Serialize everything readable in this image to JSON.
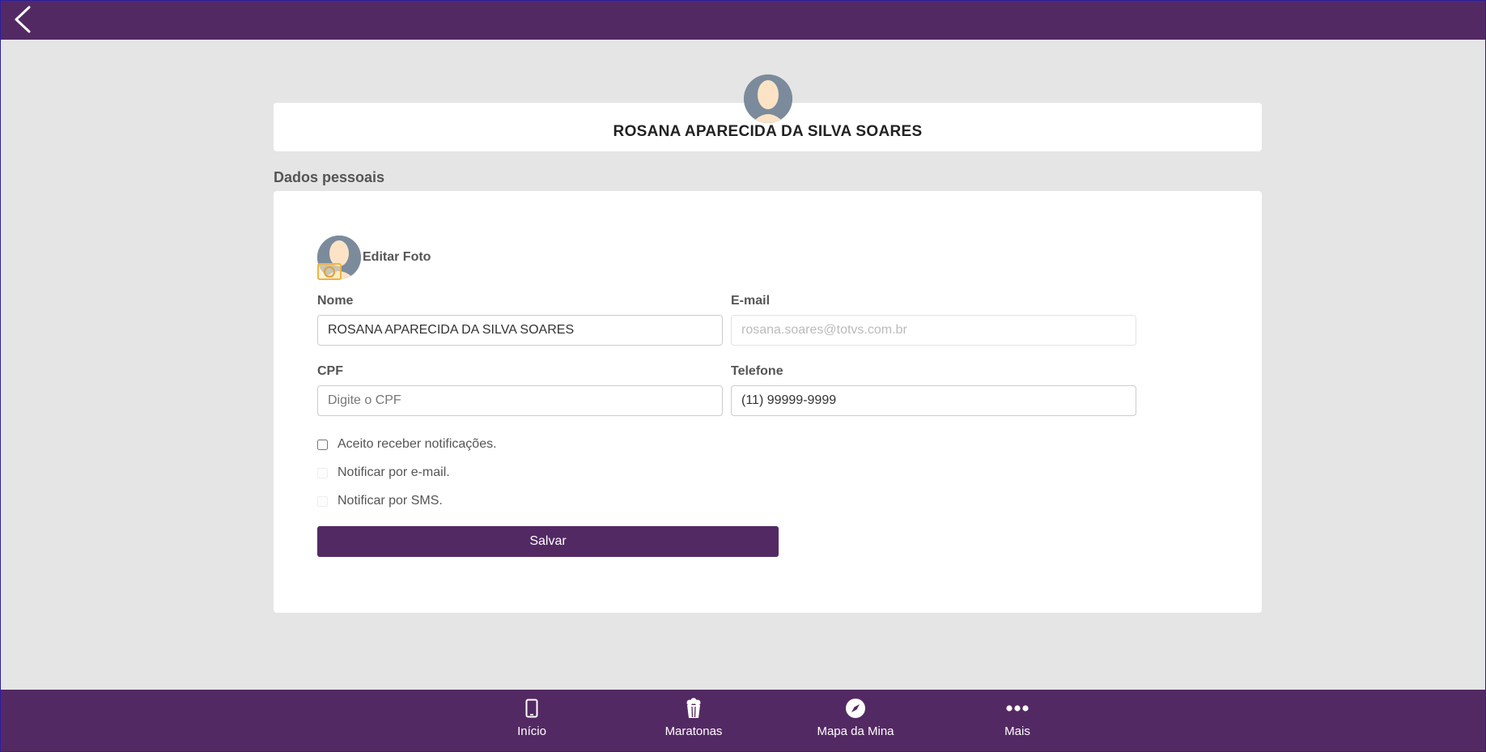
{
  "profile": {
    "name": "ROSANA APARECIDA DA SILVA SOARES"
  },
  "section": {
    "title": "Dados pessoais"
  },
  "photo": {
    "edit_label": "Editar Foto"
  },
  "form": {
    "name_label": "Nome",
    "name_value": "ROSANA APARECIDA DA SILVA SOARES",
    "email_label": "E-mail",
    "email_value": "rosana.soares@totvs.com.br",
    "cpf_label": "CPF",
    "cpf_placeholder": "Digite o CPF",
    "phone_label": "Telefone",
    "phone_value": "(11) 99999-9999",
    "accept_notifications": "Aceito receber notificações.",
    "notify_email": "Notificar por e-mail.",
    "notify_sms": "Notificar por SMS.",
    "save_label": "Salvar"
  },
  "nav": {
    "items": [
      {
        "label": "Início",
        "icon": "phone-icon"
      },
      {
        "label": "Maratonas",
        "icon": "popcorn-icon"
      },
      {
        "label": "Mapa da Mina",
        "icon": "compass-icon"
      },
      {
        "label": "Mais",
        "icon": "more-icon"
      }
    ]
  },
  "colors": {
    "primary": "#532963",
    "background": "#e5e5e5"
  }
}
